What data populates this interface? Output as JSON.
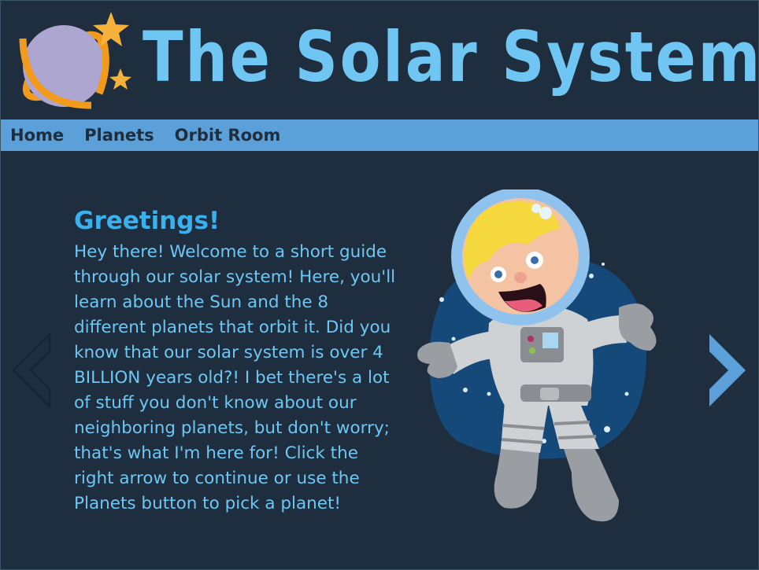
{
  "header": {
    "title": "The Solar System",
    "logo_icon": "planet-with-stars-icon"
  },
  "nav": {
    "items": [
      {
        "label": "Home"
      },
      {
        "label": "Planets"
      },
      {
        "label": "Orbit Room"
      }
    ]
  },
  "main": {
    "heading": "Greetings!",
    "body": "Hey there! Welcome to a short guide through our solar system! Here, you'll learn about the Sun and the 8 different planets that orbit it. Did you know that our solar system is over 4 BILLION years old?! I bet there's a lot of stuff you don't know about our neighboring planets, but don't worry; that's what I'm here for! Click the right arrow to continue or use the Planets button to pick a planet!"
  },
  "controls": {
    "prev_icon": "chevron-left-icon",
    "next_icon": "chevron-right-icon"
  },
  "colors": {
    "background": "#1f2e3f",
    "nav_bar": "#5ba0d8",
    "title_blue": "#6fc6f2",
    "heading_blue": "#3ab0ee",
    "planet_purple": "#ada6d0",
    "ring_orange": "#f29a1c",
    "star_yellow": "#f5b13a"
  }
}
